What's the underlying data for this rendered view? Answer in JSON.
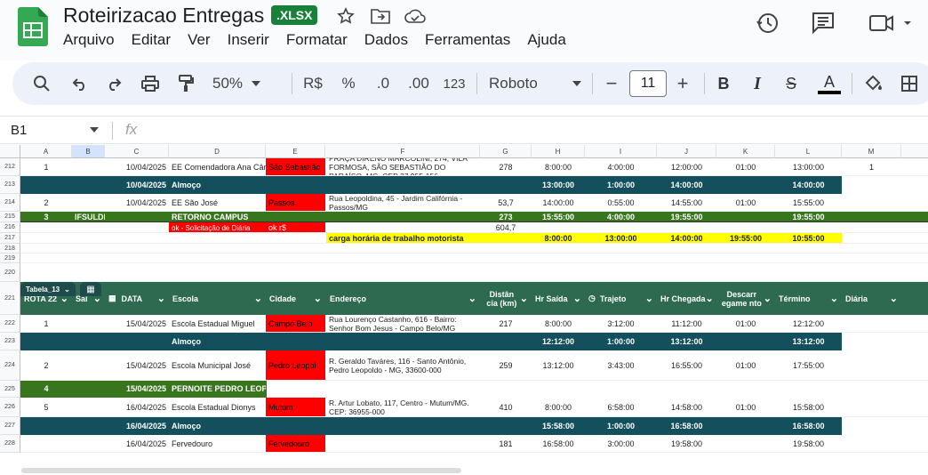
{
  "doc": {
    "title": "Roteirizacao Entregas",
    "badge": ".XLSX"
  },
  "menu": [
    "Arquivo",
    "Editar",
    "Ver",
    "Inserir",
    "Formatar",
    "Dados",
    "Ferramentas",
    "Ajuda"
  ],
  "toolbar": {
    "zoom": "50%",
    "currency": "R$",
    "percent": "%",
    "dec_down": ".0",
    "dec_up": ".00",
    "format": "123",
    "font": "Roboto",
    "font_size": "11"
  },
  "formula": {
    "cell": "B1",
    "fx": "fx"
  },
  "columns": [
    "A",
    "B",
    "C",
    "D",
    "E",
    "F",
    "G",
    "H",
    "I",
    "J",
    "K",
    "L",
    "M"
  ],
  "rows": {
    "r212": {
      "num": "212",
      "a": "1",
      "c": "10/04/2025",
      "d": "EE Comendadora Ana Cân",
      "e": "São Sebastião",
      "f": "PRAÇA DIRENO MARCOLINI, 274, VILA FORMOSA, SÃO SEBASTIÃO DO PARAÍSO, MG, CEP 37.955-156",
      "g": "278",
      "h": "8:00:00",
      "i": "4:00:00",
      "j": "12:00:00",
      "k": "01:00",
      "l": "13:00:00",
      "m": "1"
    },
    "r213": {
      "num": "213",
      "c": "10/04/2025",
      "d": "Almoço",
      "h": "13:00:00",
      "i": "1:00:00",
      "j": "14:00:00",
      "l": "14:00:00"
    },
    "r214": {
      "num": "214",
      "a": "2",
      "c": "10/04/2025",
      "d": "EE São José",
      "e": "Passos",
      "f": "Rua Leopoldina, 45 - Jardim Califórnia - Passos/MG",
      "g": "53,7",
      "h": "14:00:00",
      "i": "0:55:00",
      "j": "14:55:00",
      "k": "01:00",
      "l": "15:55:00"
    },
    "r215": {
      "num": "215",
      "a": "3",
      "b": "IFSULDEMINAS",
      "d": "RETORNO CAMPUS",
      "g": "273",
      "h": "15:55:00",
      "i": "4:00:00",
      "j": "19:55:00",
      "l": "19:55:00"
    },
    "r216": {
      "num": "216",
      "d": "ok - Solicitação de Diária",
      "e": "ok r$",
      "g": "604,7"
    },
    "r217": {
      "num": "217",
      "f": "carga horária de trabalho motorista",
      "h": "8:00:00",
      "i": "13:00:00",
      "j": "14:00:00",
      "k": "19:55:00",
      "l": "10:55:00"
    },
    "r218": {
      "num": "218"
    },
    "r219": {
      "num": "219"
    },
    "r220": {
      "num": "220"
    },
    "r221": {
      "num": "221"
    },
    "r222": {
      "num": "222",
      "a": "1",
      "c": "15/04/2025",
      "d": "Escola Estadual Miguel",
      "e": "Campo Belo",
      "f": "Rua Lourenço Castanho, 616 - Bairro: Senhor Bom Jesus - Campo Belo/MG",
      "g": "217",
      "h": "8:00:00",
      "i": "3:12:00",
      "j": "11:12:00",
      "k": "01:00",
      "l": "12:12:00"
    },
    "r223": {
      "num": "223",
      "d": "Almoço",
      "h": "12:12:00",
      "i": "1:00:00",
      "j": "13:12:00",
      "l": "13:12:00"
    },
    "r224": {
      "num": "224",
      "a": "2",
      "c": "15/04/2025",
      "d": "Escola Municipal José",
      "e": "Pedro Leopol",
      "f": "R. Geraldo Taváres, 116 - Santo Antônio, Pedro Leopoldo - MG, 33600-000",
      "g": "259",
      "h": "13:12:00",
      "i": "3:43:00",
      "j": "16:55:00",
      "k": "01:00",
      "l": "17:55:00"
    },
    "r225": {
      "num": "225",
      "a": "4",
      "c": "15/04/2025",
      "d": "PERNOITE PEDRO LEOPO"
    },
    "r226": {
      "num": "226",
      "a": "5",
      "c": "16/04/2025",
      "d": "Escola Estadual Dionys",
      "e": "Mutum",
      "f": "R. Artur Lobato, 117, Centro - Mutum/MG. CEP: 36955-000",
      "g": "410",
      "h": "8:00:00",
      "i": "6:58:00",
      "j": "14:58:00",
      "k": "01:00",
      "l": "15:58:00"
    },
    "r227": {
      "num": "227",
      "c": "16/04/2025",
      "d": "Almoço",
      "h": "15:58:00",
      "i": "1:00:00",
      "j": "16:58:00",
      "l": "16:58:00"
    },
    "r228": {
      "num": "228",
      "c": "16/04/2025",
      "d": "Fervedouro",
      "e": "Fervedouro",
      "g": "181",
      "h": "16:58:00",
      "i": "3:00:00",
      "j": "19:58:00",
      "l": "19:58:00"
    }
  },
  "table": {
    "name": "Tabela_13",
    "headers": [
      "ROTA 22",
      "Saí",
      "DATA",
      "Escola",
      "Cidade",
      "Endereço",
      "Distân cia (km)",
      "Hr Saída",
      "Trajeto",
      "Hr Chegada",
      "Descarr egame nto",
      "Término",
      "Diária"
    ]
  },
  "colors": {
    "teal": "#134f5c",
    "green": "#38761d",
    "red": "#ff0000",
    "yellow": "#ffff00",
    "table_header": "#2d6a4f"
  }
}
